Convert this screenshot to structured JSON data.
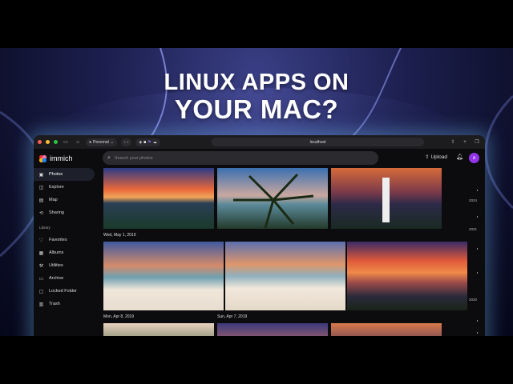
{
  "headline": {
    "line1": "LINUX APPS ON",
    "line2": "YOUR MAC?"
  },
  "browser": {
    "profile": "Personal",
    "url": "localhost"
  },
  "app": {
    "name": "immich",
    "search_placeholder": "Search your photos",
    "upload_label": "Upload",
    "avatar_initial": "A"
  },
  "sidebar": {
    "items": [
      {
        "label": "Photos",
        "icon": "photos-icon"
      },
      {
        "label": "Explore",
        "icon": "explore-icon"
      },
      {
        "label": "Map",
        "icon": "map-icon"
      },
      {
        "label": "Sharing",
        "icon": "sharing-icon"
      }
    ],
    "library_label": "Library",
    "library_items": [
      {
        "label": "Favorites",
        "icon": "heart-icon"
      },
      {
        "label": "Albums",
        "icon": "albums-icon"
      },
      {
        "label": "Utilities",
        "icon": "utilities-icon"
      },
      {
        "label": "Archive",
        "icon": "archive-icon"
      },
      {
        "label": "Locked Folder",
        "icon": "lock-icon"
      },
      {
        "label": "Trash",
        "icon": "trash-icon"
      }
    ]
  },
  "timeline": {
    "dates": [
      "Wed, May 1, 2019",
      "Mon, Apr 8, 2019",
      "Sun, Apr 7, 2019"
    ],
    "years": [
      "2024",
      "2021",
      "2020"
    ]
  },
  "colors": {
    "accent": "#9333ea",
    "background": "#0c0c0e",
    "active_nav": "#1d1f2b"
  }
}
